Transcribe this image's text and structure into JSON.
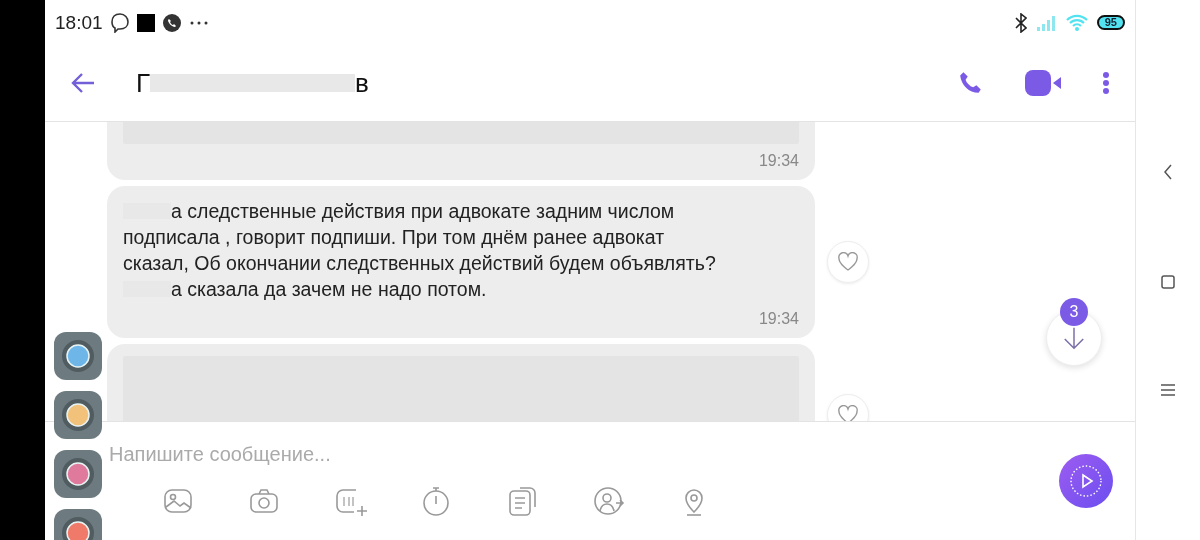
{
  "status_bar": {
    "time": "18:01",
    "battery": "95"
  },
  "header": {
    "title_start": "Г",
    "title_end": "в"
  },
  "messages": [
    {
      "kind": "media",
      "time": "19:34"
    },
    {
      "kind": "text",
      "time": "19:34",
      "lines": [
        {
          "text": "а следственные действия при адвокате задним числом",
          "redacted_start": true
        },
        {
          "text": "подписала , говорит подпиши. При том днём ранее адвокат",
          "redacted_start": false
        },
        {
          "text": "сказал, Об окончании следственных действий будем объявлять?",
          "redacted_start": false
        },
        {
          "text": "а сказала да зачем не надо потом.",
          "redacted_start": true
        }
      ]
    },
    {
      "kind": "media_cut"
    }
  ],
  "scroll_down": {
    "badge": "3"
  },
  "composer": {
    "placeholder": "Напишите сообщение..."
  }
}
